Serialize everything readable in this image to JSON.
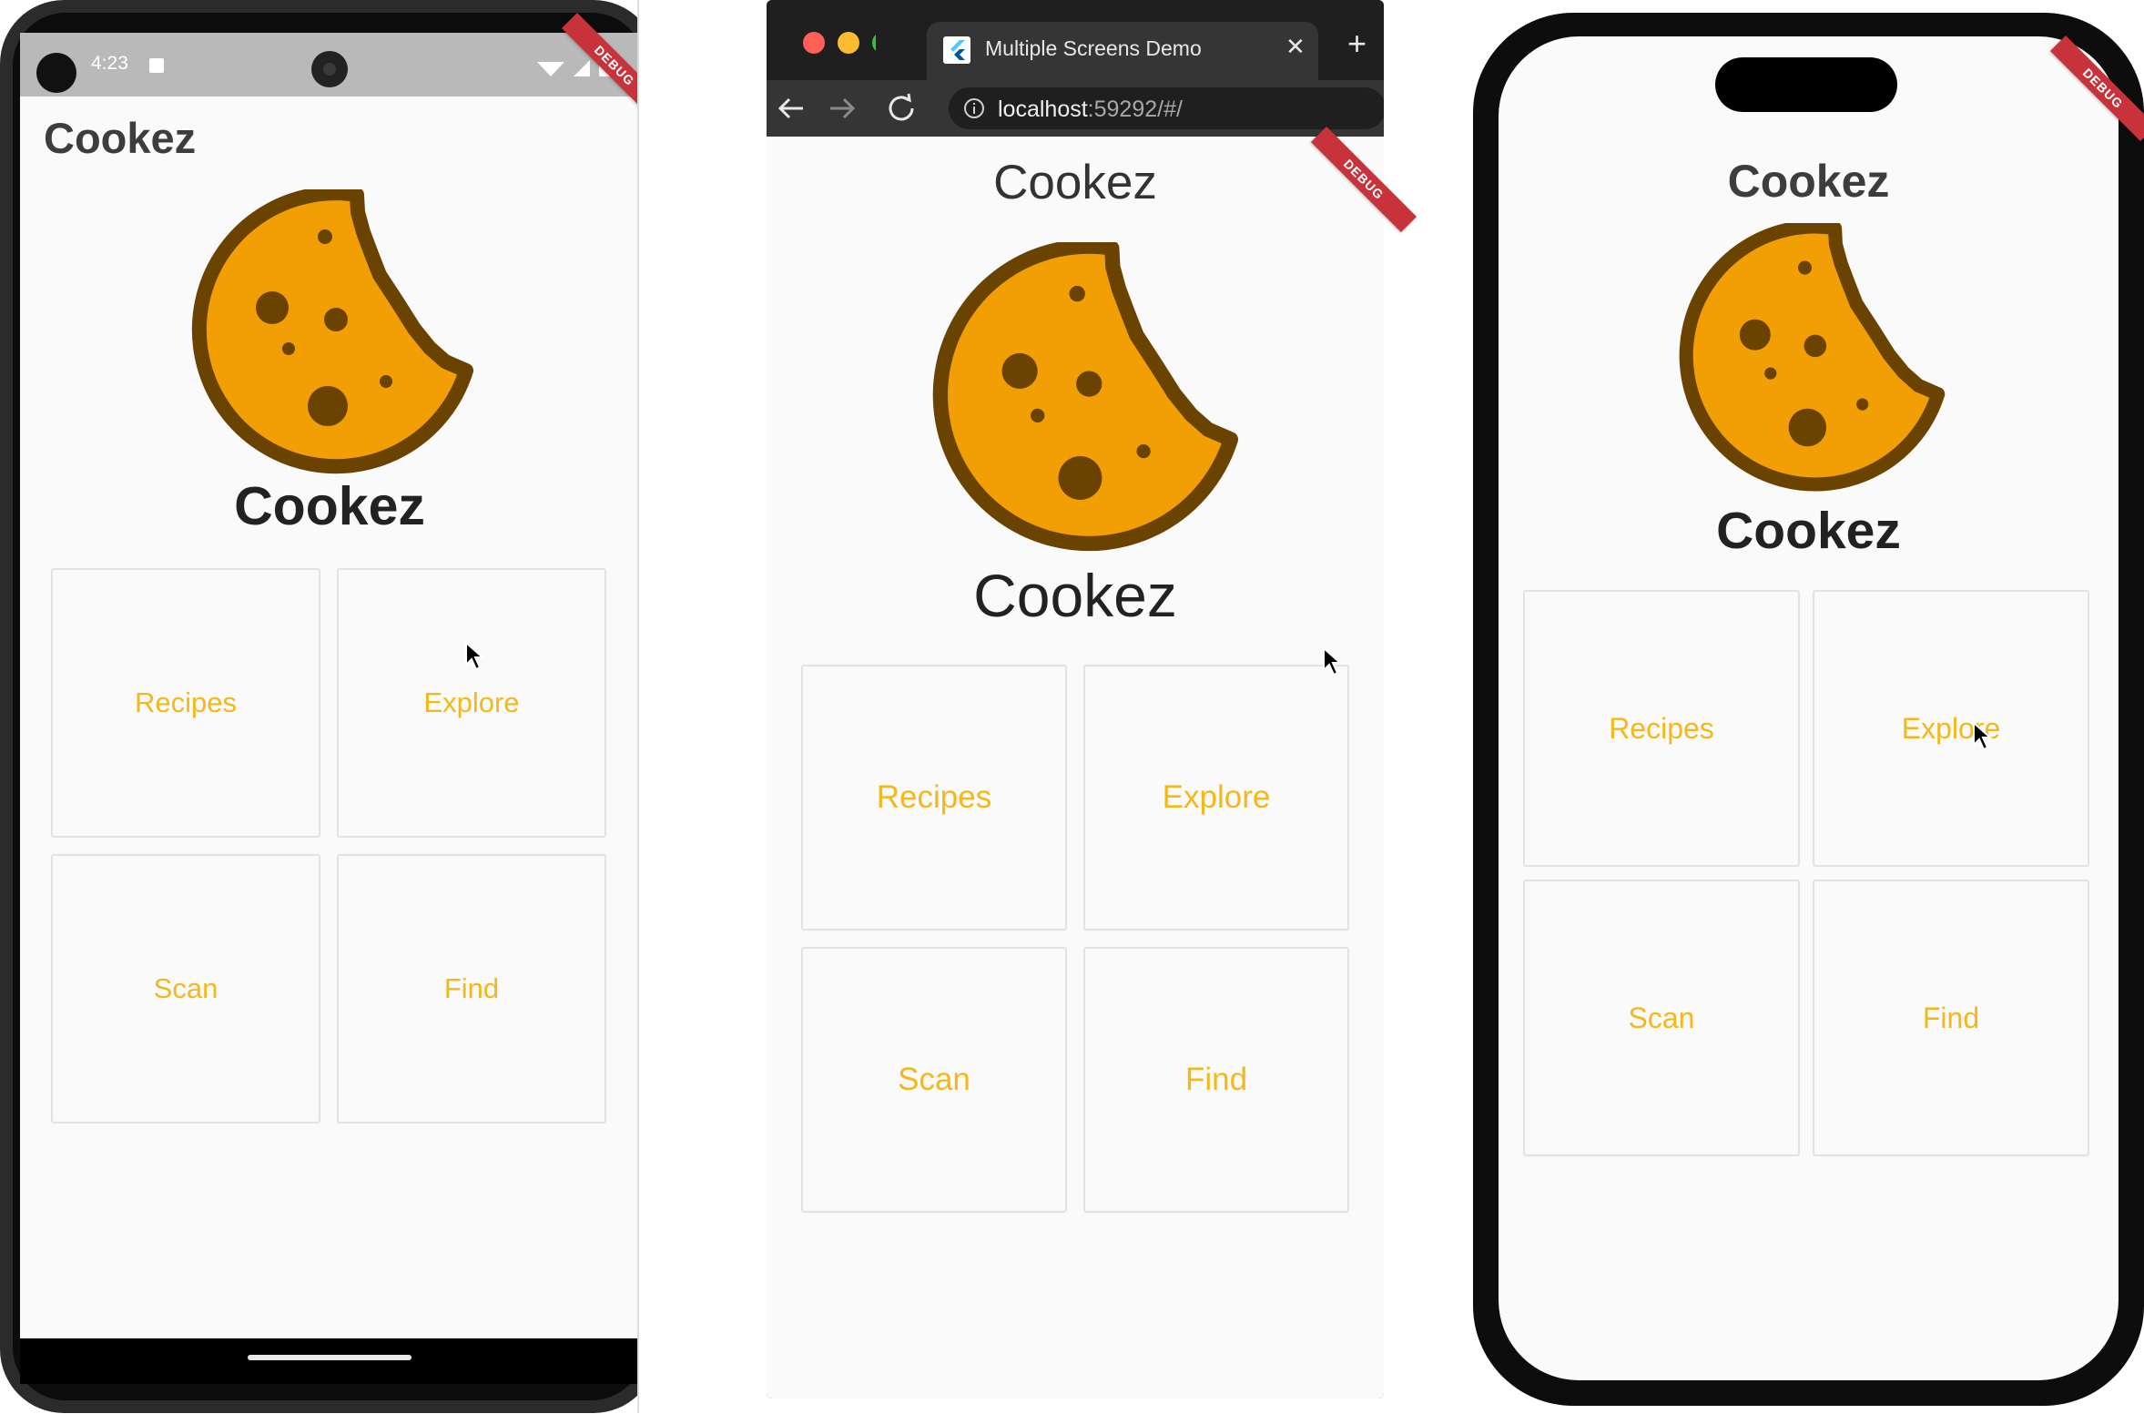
{
  "brand_colors": {
    "accent_text": "#f2b81c",
    "cookie_fill": "#f29f05",
    "cookie_outline": "#6b4300",
    "debug_banner": "#c8323a"
  },
  "android": {
    "status_time": "4:23",
    "app_title": "Cookez",
    "logo_text": "Cookez",
    "debug_label": "DEBUG",
    "tiles": [
      "Recipes",
      "Explore",
      "Scan",
      "Find"
    ]
  },
  "browser": {
    "tab_title": "Multiple Screens Demo",
    "url_host": "localhost",
    "url_rest": ":59292/#/",
    "app_title": "Cookez",
    "logo_text": "Cookez",
    "debug_label": "DEBUG",
    "tiles": [
      "Recipes",
      "Explore",
      "Scan",
      "Find"
    ]
  },
  "iphone": {
    "app_title": "Cookez",
    "logo_text": "Cookez",
    "debug_label": "DEBUG",
    "tiles": [
      "Recipes",
      "Explore",
      "Scan",
      "Find"
    ]
  }
}
